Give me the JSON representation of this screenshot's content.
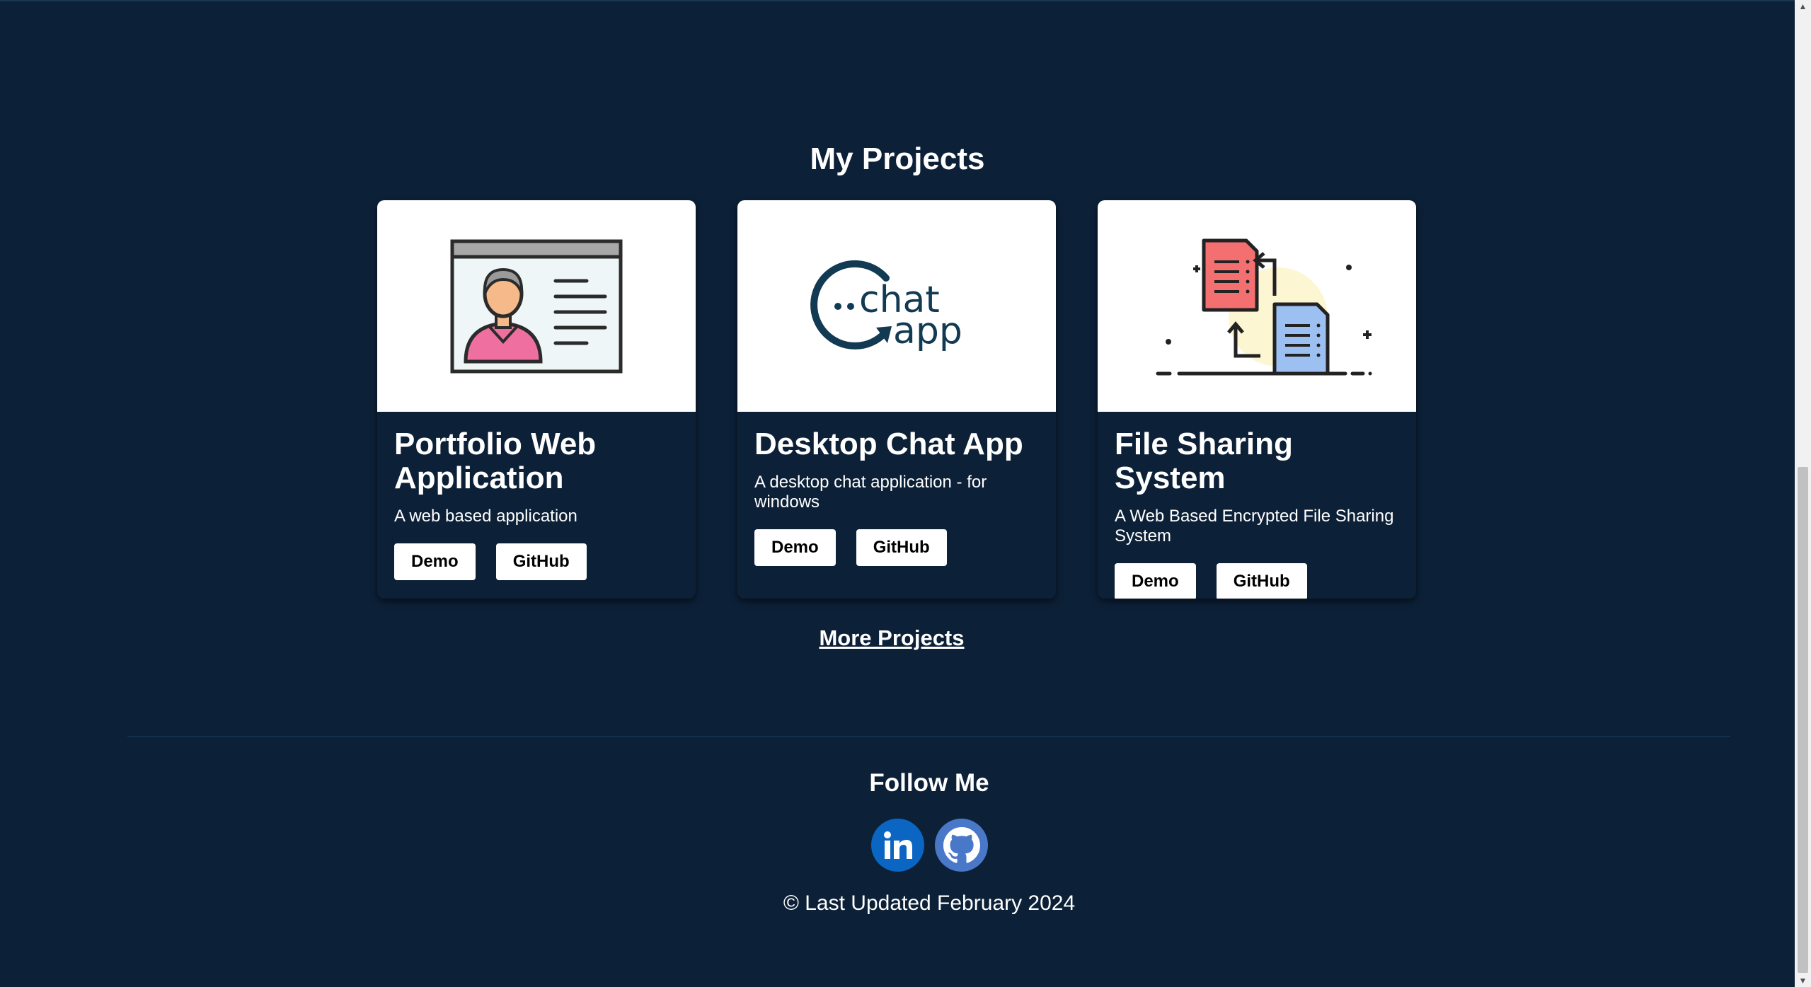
{
  "projects": {
    "title": "My Projects",
    "cards": [
      {
        "title": "Portfolio Web Application",
        "description": "A web based application",
        "demo_label": "Demo",
        "github_label": "GitHub",
        "image_icon": "profile-card-icon"
      },
      {
        "title": "Desktop Chat App",
        "description": "A desktop chat application - for windows",
        "demo_label": "Demo",
        "github_label": "GitHub",
        "image_icon": "chat-app-logo",
        "logo_text_1": "chat",
        "logo_text_2": "app"
      },
      {
        "title": "File Sharing System",
        "description": "A Web Based Encrypted File Sharing System",
        "demo_label": "Demo",
        "github_label": "GitHub",
        "image_icon": "file-transfer-icon"
      }
    ],
    "more_link": "More Projects"
  },
  "footer": {
    "follow_title": "Follow Me",
    "socials": [
      "linkedin-icon",
      "github-icon"
    ],
    "copyright": "© Last Updated February 2024"
  },
  "colors": {
    "background": "#0c2037",
    "linkedin": "#0a66c2",
    "github": "#4a78c8",
    "logo_teal": "#123a52"
  }
}
